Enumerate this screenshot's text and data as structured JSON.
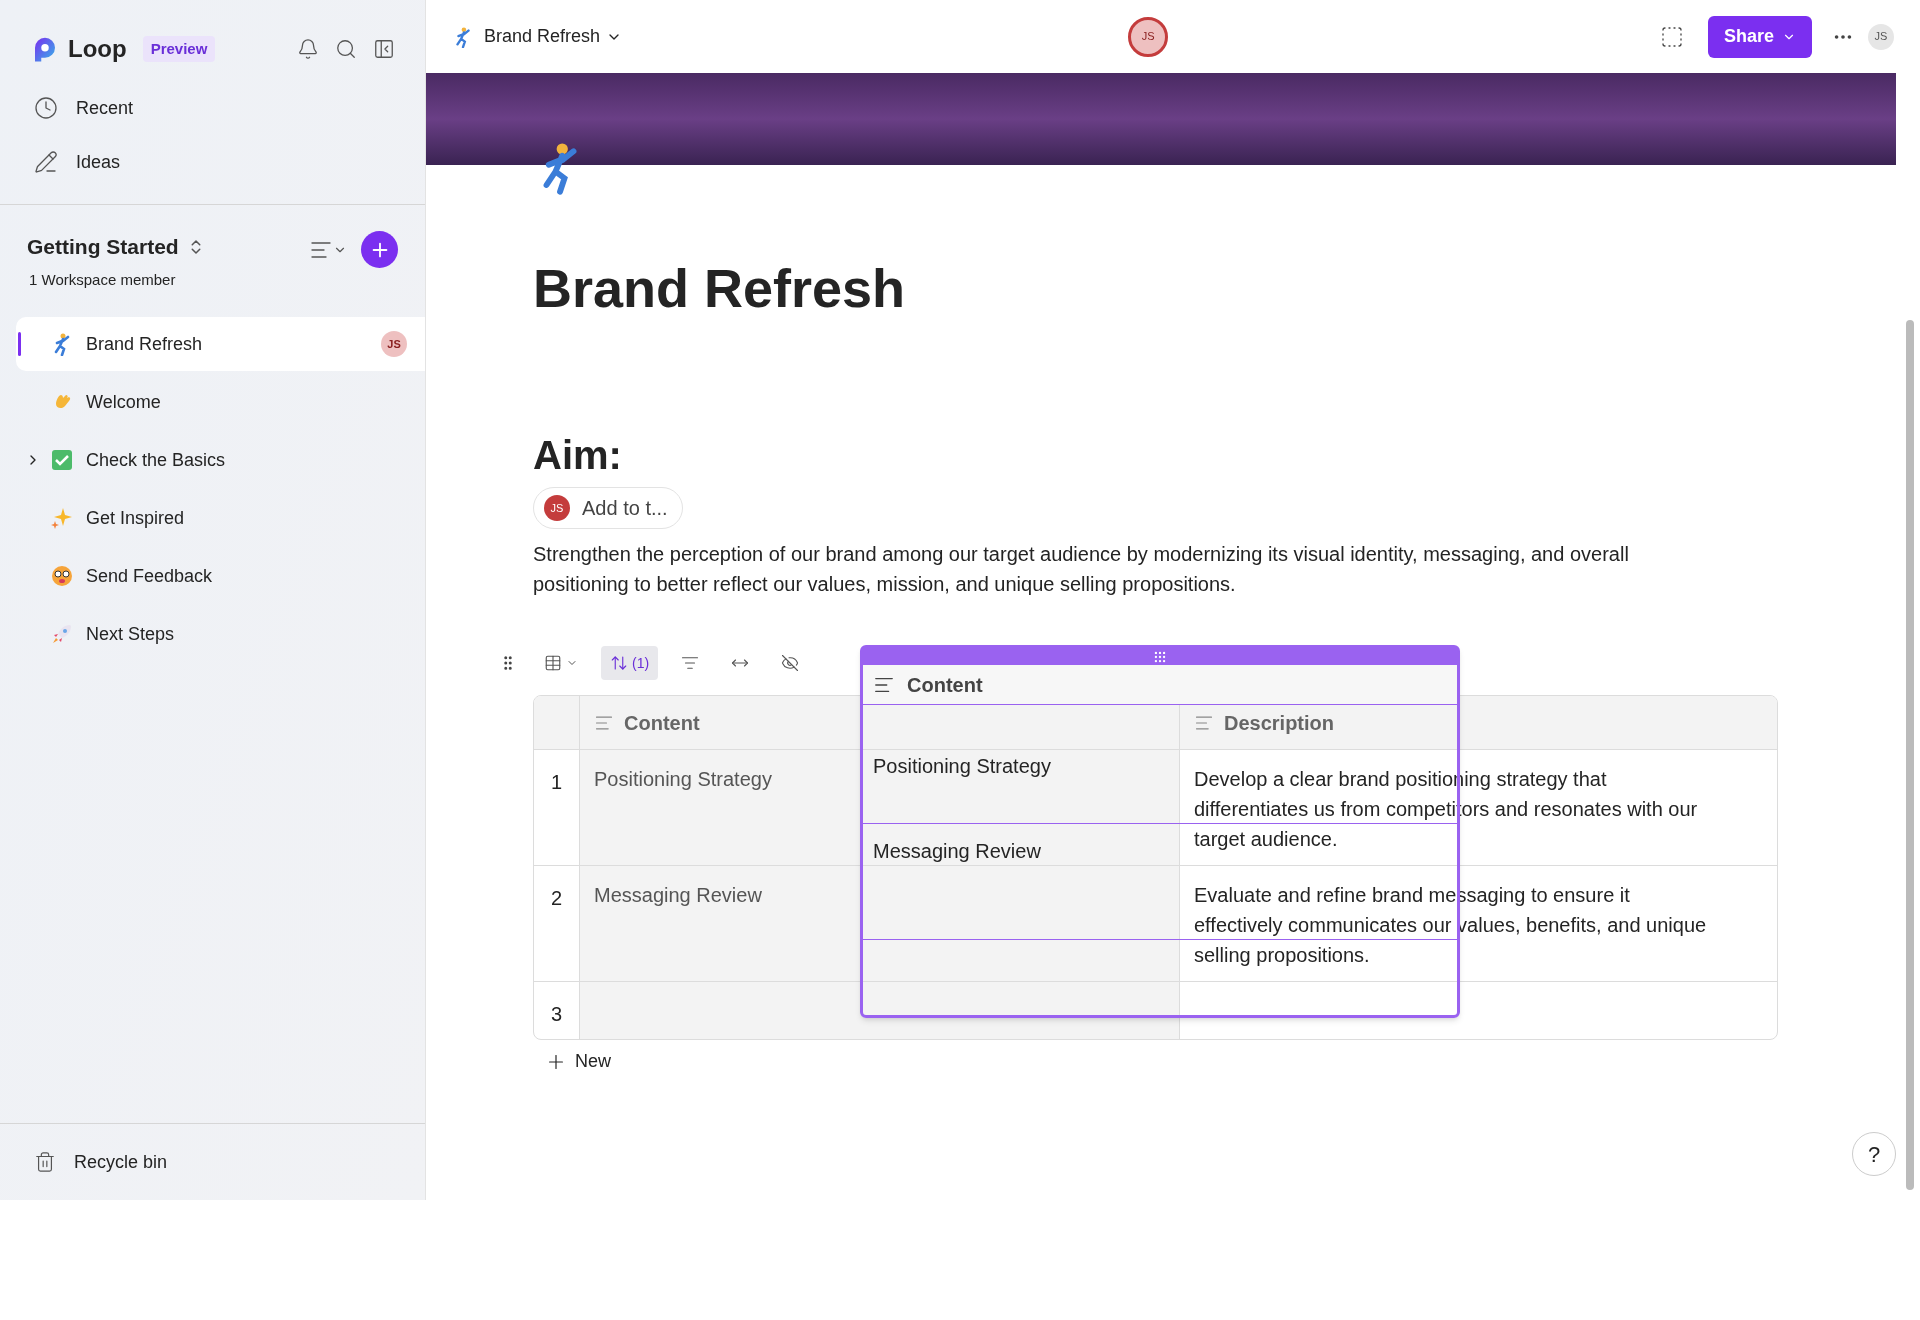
{
  "sidebar": {
    "app_name": "Loop",
    "badge": "Preview",
    "nav": [
      {
        "label": "Recent"
      },
      {
        "label": "Ideas"
      }
    ],
    "workspace": {
      "title": "Getting Started",
      "subtitle": "1 Workspace member"
    },
    "pages": [
      {
        "label": "Brand Refresh",
        "kind": "page",
        "selected": true,
        "avatar": "JS"
      },
      {
        "label": "Welcome",
        "kind": "page",
        "selected": false
      },
      {
        "label": "Check the Basics",
        "kind": "folder",
        "selected": false,
        "expanded": false
      },
      {
        "label": "Get Inspired",
        "kind": "page",
        "selected": false
      },
      {
        "label": "Send Feedback",
        "kind": "page",
        "selected": false
      },
      {
        "label": "Next Steps",
        "kind": "page",
        "selected": false
      }
    ],
    "footer": {
      "label": "Recycle bin"
    }
  },
  "topbar": {
    "title": "Brand Refresh",
    "presence": "JS",
    "share": "Share",
    "account": "JS"
  },
  "page": {
    "title": "Brand Refresh",
    "heading": "Aim:",
    "assign": {
      "avatar": "JS",
      "label": "Add to t..."
    },
    "paragraph": "Strengthen the perception of our brand among our target audience by modernizing its visual identity, messaging, and overall positioning to better reflect our values, mission, and unique selling propositions."
  },
  "toolbar": [
    {
      "kind": "grid",
      "selected": false
    },
    {
      "kind": "sort",
      "label": "(1)",
      "selected": true
    },
    {
      "kind": "filter",
      "selected": false
    },
    {
      "kind": "width",
      "selected": false
    },
    {
      "kind": "hide",
      "selected": false
    }
  ],
  "table": {
    "columns": [
      {
        "label": "Content"
      },
      {
        "label": "Description"
      }
    ],
    "rows": [
      {
        "number": "1",
        "content": "Positioning Strategy",
        "description": "Develop a clear brand positioning strategy that differentiates us from competitors and resonates with our target audience."
      },
      {
        "number": "2",
        "content": "Messaging Review",
        "description": "Evaluate and refine brand messaging to ensure it effectively communicates our values, benefits, and unique selling propositions."
      },
      {
        "number": "3"
      }
    ],
    "new_row": "New"
  },
  "drag_preview": {
    "header": "Content",
    "rows": [
      "Positioning Strategy",
      "Messaging Review"
    ]
  },
  "help": "?"
}
